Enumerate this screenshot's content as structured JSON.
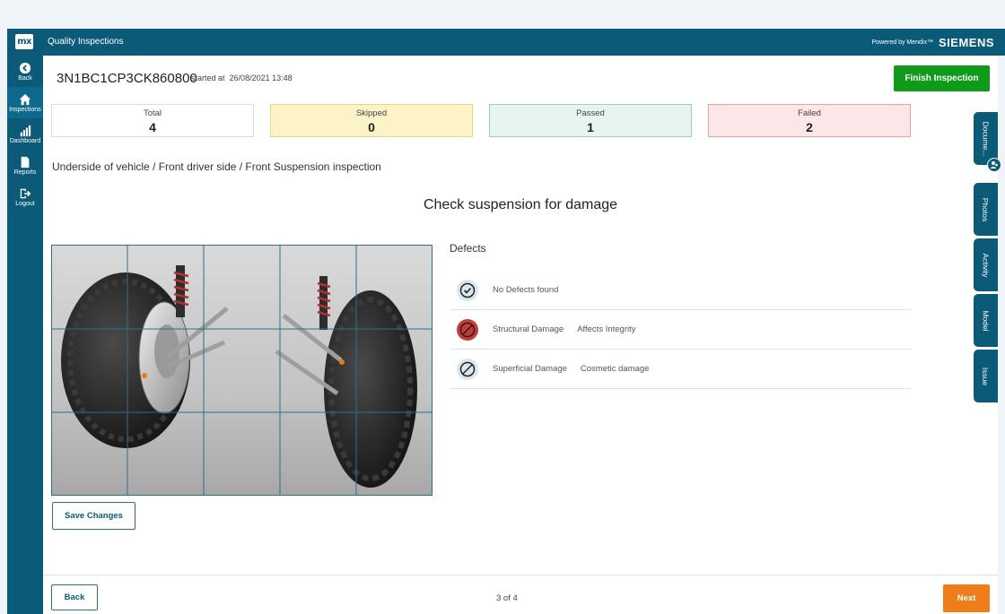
{
  "app": {
    "logo": "mx",
    "title": "Quality Inspections",
    "powered_by": "Powered by Mendix™",
    "brand": "SIEMENS"
  },
  "nav": [
    {
      "label": "Back",
      "icon": "back-arrow-icon"
    },
    {
      "label": "Inspections",
      "icon": "home-icon",
      "active": true
    },
    {
      "label": "Dashboard",
      "icon": "bar-chart-icon"
    },
    {
      "label": "Reports",
      "icon": "document-icon"
    },
    {
      "label": "Logout",
      "icon": "logout-icon"
    }
  ],
  "header": {
    "vin": "3N1BC1CP3CK860800",
    "started_label": "started at",
    "started_at": "26/08/2021 13:48",
    "finish_label": "Finish Inspection"
  },
  "stats": {
    "total": {
      "label": "Total",
      "value": "4"
    },
    "skipped": {
      "label": "Skipped",
      "value": "0"
    },
    "passed": {
      "label": "Passed",
      "value": "1"
    },
    "failed": {
      "label": "Failed",
      "value": "2"
    }
  },
  "breadcrumb": "Underside of vehicle / Front driver side / Front Suspension inspection",
  "question": "Check suspension for damage",
  "defects": {
    "title": "Defects",
    "items": [
      {
        "name": "No Defects found",
        "desc": "",
        "icon": "check-circle-icon"
      },
      {
        "name": "Structural Damage",
        "desc": "Affects Integrity",
        "icon": "prohibited-icon"
      },
      {
        "name": "Superficial Damage",
        "desc": "Cosmetic damage",
        "icon": "slash-circle-icon"
      }
    ]
  },
  "actions": {
    "save": "Save Changes",
    "back": "Back",
    "pager": "3 of 4",
    "next": "Next"
  },
  "side_tabs": [
    "Docume...",
    "Photos",
    "Activity",
    "Model",
    "Issue"
  ],
  "colors": {
    "primary": "#0b5a78",
    "finish": "#0f9a1a",
    "next": "#ef7d1a",
    "failed_bg": "#fbe7e7",
    "passed_bg": "#e6f5ee",
    "skipped_bg": "#fdf3c8"
  }
}
